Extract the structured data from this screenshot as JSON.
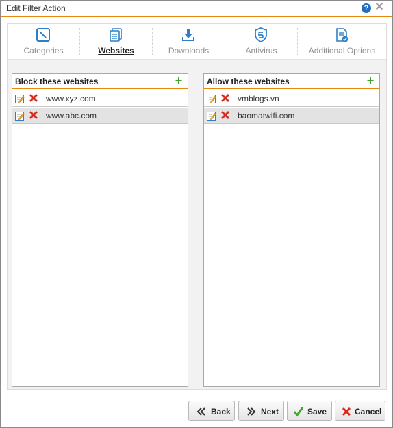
{
  "dialog": {
    "title": "Edit Filter Action",
    "help_icon": "?",
    "close_icon": "✕"
  },
  "tabs": [
    {
      "label": "Categories",
      "icon": "categories-icon",
      "active": false
    },
    {
      "label": "Websites",
      "icon": "websites-icon",
      "active": true
    },
    {
      "label": "Downloads",
      "icon": "downloads-icon",
      "active": false
    },
    {
      "label": "Antivirus",
      "icon": "antivirus-icon",
      "active": false
    },
    {
      "label": "Additional Options",
      "icon": "additional-options-icon",
      "active": false
    }
  ],
  "block_panel": {
    "title": "Block these websites",
    "add_icon": "+",
    "items": [
      {
        "url": "www.xyz.com",
        "selected": false
      },
      {
        "url": "www.abc.com",
        "selected": true
      }
    ]
  },
  "allow_panel": {
    "title": "Allow these websites",
    "add_icon": "+",
    "items": [
      {
        "url": "vmblogs.vn",
        "selected": false
      },
      {
        "url": "baomatwifi.com",
        "selected": true
      }
    ]
  },
  "buttons": {
    "back": "Back",
    "next": "Next",
    "save": "Save",
    "cancel": "Cancel"
  },
  "colors": {
    "accent_orange": "#e8870e",
    "add_green": "#3fa52c",
    "delete_red": "#d62b1f",
    "icon_blue": "#2f7fc8",
    "help_blue": "#1e6fc0"
  }
}
